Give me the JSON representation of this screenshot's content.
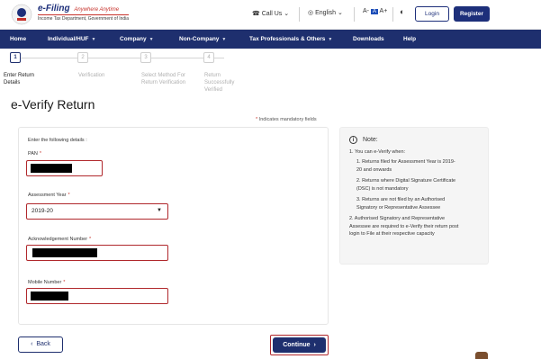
{
  "header": {
    "brand_title": "e-Filing",
    "brand_tagline": "Anywhere Anytime",
    "brand_sub": "Income Tax Department, Government of India",
    "call_us": "Call Us",
    "language": "English",
    "font_small": "A-",
    "font_mid": "A",
    "font_large": "A+",
    "login": "Login",
    "register": "Register"
  },
  "nav": {
    "items": [
      {
        "label": "Home",
        "dropdown": false
      },
      {
        "label": "Individual/HUF",
        "dropdown": true
      },
      {
        "label": "Company",
        "dropdown": true
      },
      {
        "label": "Non-Company",
        "dropdown": true
      },
      {
        "label": "Tax Professionals & Others",
        "dropdown": true
      },
      {
        "label": "Downloads",
        "dropdown": false
      },
      {
        "label": "Help",
        "dropdown": false
      }
    ]
  },
  "stepper": {
    "current": 1,
    "steps": [
      {
        "number": "1",
        "line1": "Enter Return",
        "line2": "Details",
        "line3": ""
      },
      {
        "number": "2",
        "line1": "Verification",
        "line2": "",
        "line3": ""
      },
      {
        "number": "3",
        "line1": "Select Method For",
        "line2": "Return Verification",
        "line3": ""
      },
      {
        "number": "4",
        "line1": "Return",
        "line2": "Successfully",
        "line3": "Verified"
      }
    ]
  },
  "page": {
    "title": "e-Verify Return",
    "mandatory_note": "Indicates mandatory fields"
  },
  "form": {
    "intro": "Enter the following details :",
    "pan_label": "PAN",
    "assessment_year_label": "Assessment Year",
    "assessment_year_value": "2019-20",
    "ack_label": "Acknowledgement Number",
    "mobile_label": "Mobile Number"
  },
  "note": {
    "heading": "Note:",
    "intro": "1. You can e-Verify when:",
    "l1a": "1. Returns filed for Assessment Year is 2019-",
    "l1b": "20 and onwards",
    "l2a": "2. Returns where Digital Signature Certificate",
    "l2b": "(DSC) is not mandatory",
    "l3a": "3. Returns are not filed by an Authorised",
    "l3b": "Signatory or Representative Assessee",
    "l4a": "2. Authorised Signatory and Representative",
    "l4b": "Assessee are required to e-Verify their return post",
    "l4c": "login to File at their respective capacity"
  },
  "actions": {
    "back": "Back",
    "continue": "Continue"
  },
  "colors": {
    "navy": "#1e2f6e",
    "highlight_red": "#b0282c",
    "mandatory_red": "#c7322b"
  }
}
